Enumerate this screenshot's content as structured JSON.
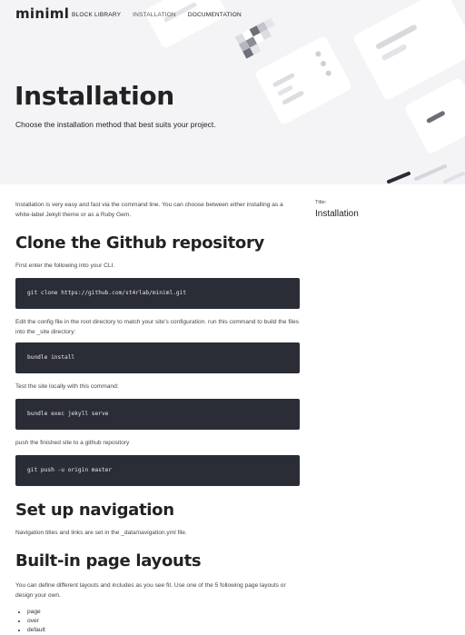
{
  "brand": {
    "logo": "miniml"
  },
  "nav": [
    {
      "label": "BLOCK LIBRARY"
    },
    {
      "label": "INSTALLATION"
    },
    {
      "label": "DOCUMENTATION"
    }
  ],
  "hero": {
    "title": "Installation",
    "subtitle": "Choose the installation method that best suits your project."
  },
  "content": {
    "intro": "Installation is very easy and fast via the command line. You can choose between either installing as a white-label Jekyll theme or as a Ruby Gem.",
    "section1_title": "Clone the Github repository",
    "step1_text": "First enter the following into your CLI.",
    "code1": "git clone https://github.com/st4rlab/miniml.git",
    "step2_text": "Edit the config file in the root directory to match your site's configuration. run this command to build the files into the _site directory:",
    "code2": "bundle install",
    "step3_text": "Test the site locally with this command:",
    "code3": "bundle exec jekyll serve",
    "step4_text": "push the finished site to a github repository",
    "code4": "git push -u origin master",
    "section2_title": "Set up navigation",
    "nav_text": "Navigation titles and links are set in the _data/navigation.yml file.",
    "section3_title": "Built-in page layouts",
    "layouts_text": "You can define different layouts and includes as you see fit. Use one of the 5 following page layouts or design your own.",
    "layouts": [
      "page",
      "over",
      "default"
    ]
  },
  "sidebar": {
    "label": "Title:",
    "title": "Installation"
  }
}
